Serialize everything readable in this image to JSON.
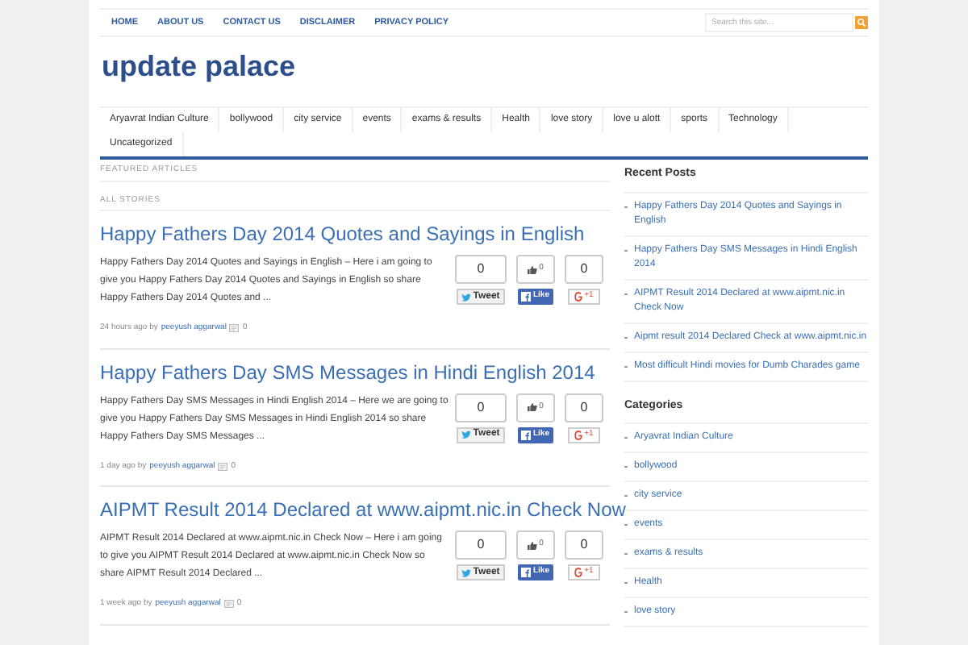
{
  "top_nav": {
    "items": [
      {
        "label": "HOME"
      },
      {
        "label": "ABOUT US"
      },
      {
        "label": "CONTACT US"
      },
      {
        "label": "DISCLAIMER"
      },
      {
        "label": "PRIVACY POLICY"
      }
    ]
  },
  "search": {
    "placeholder": "Search this site..."
  },
  "site_title": "update palace",
  "category_nav": {
    "items": [
      {
        "label": "Aryavrat Indian Culture"
      },
      {
        "label": "bollywood"
      },
      {
        "label": "city service"
      },
      {
        "label": "events"
      },
      {
        "label": "exams & results"
      },
      {
        "label": "Health"
      },
      {
        "label": "love story"
      },
      {
        "label": "love u alott"
      },
      {
        "label": "sports"
      },
      {
        "label": "Technology"
      },
      {
        "label": "Uncategorized"
      }
    ]
  },
  "featured_heading": "FEATURED ARTICLES",
  "stories_heading": "ALL STORIES",
  "posts": [
    {
      "title": "Happy Fathers Day 2014 Quotes and Sayings in English",
      "excerpt": "Happy Fathers Day 2014 Quotes and Sayings in English – Here i am going to give you Happy Fathers Day 2014 Quotes and Sayings in English so share Happy Fathers Day 2014 Quotes and ...",
      "time": "24 hours ago by",
      "author": "peeyush aggarwal",
      "comments": "0",
      "tweet_count": "0",
      "tweet_label": "Tweet",
      "like_count": "0",
      "like_label": "Like",
      "plus_count": "0",
      "plus_label": "+1"
    },
    {
      "title": "Happy Fathers Day SMS Messages in Hindi English 2014",
      "excerpt": "Happy Fathers Day SMS Messages in Hindi English 2014 – Here we are going to give you Happy Fathers Day SMS Messages in Hindi English 2014 so share Happy Fathers Day SMS Messages ...",
      "time": "1 day ago by",
      "author": "peeyush aggarwal",
      "comments": "0",
      "tweet_count": "0",
      "tweet_label": "Tweet",
      "like_count": "0",
      "like_label": "Like",
      "plus_count": "0",
      "plus_label": "+1"
    },
    {
      "title": "AIPMT Result 2014 Declared at www.aipmt.nic.in Check Now",
      "excerpt": "AIPMT Result 2014 Declared at www.aipmt.nic.in Check Now – Here i am going to give you AIPMT Result 2014 Declared at www.aipmt.nic.in Check Now so share AIPMT Result 2014 Declared ...",
      "time": "1 week ago by",
      "author": "peeyush aggarwal",
      "comments": "0",
      "tweet_count": "0",
      "tweet_label": "Tweet",
      "like_count": "0",
      "like_label": "Like",
      "plus_count": "0",
      "plus_label": "+1"
    }
  ],
  "sidebar": {
    "recent_posts": {
      "title": "Recent Posts",
      "items": [
        {
          "label": "Happy Fathers Day 2014 Quotes and Sayings in English"
        },
        {
          "label": "Happy Fathers Day SMS Messages in Hindi English 2014"
        },
        {
          "label": "AIPMT Result 2014 Declared at www.aipmt.nic.in Check Now"
        },
        {
          "label": "Aipmt result 2014 Declared Check at www.aipmt.nic.in"
        },
        {
          "label": "Most difficult Hindi movies for Dumb Charades game"
        }
      ]
    },
    "categories": {
      "title": "Categories",
      "items": [
        {
          "label": "Aryavrat Indian Culture"
        },
        {
          "label": "bollywood"
        },
        {
          "label": "city service"
        },
        {
          "label": "events"
        },
        {
          "label": "exams & results"
        },
        {
          "label": "Health"
        },
        {
          "label": "love story"
        }
      ]
    }
  }
}
